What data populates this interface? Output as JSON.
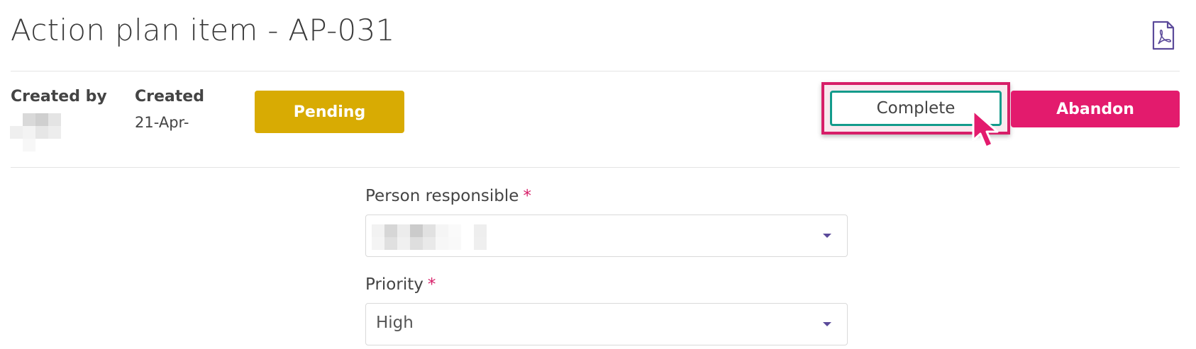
{
  "header": {
    "title": "Action plan item - AP-031",
    "pdf_icon": "pdf-file-icon"
  },
  "meta": {
    "created_by_label": "Created by",
    "created_label": "Created",
    "created_value": "21-Apr-"
  },
  "status": {
    "label": "Pending",
    "color": "#d8ab03"
  },
  "actions": {
    "complete_label": "Complete",
    "abandon_label": "Abandon",
    "complete_border_color": "#139b8b",
    "highlight_color": "#d71e68",
    "abandon_color": "#e31b6d"
  },
  "form": {
    "person_responsible": {
      "label": "Person responsible",
      "required_mark": "*"
    },
    "priority": {
      "label": "Priority",
      "required_mark": "*",
      "value": "High"
    }
  },
  "icons": {
    "dropdown": "chevron-down-icon",
    "cursor": "mouse-pointer-icon"
  }
}
